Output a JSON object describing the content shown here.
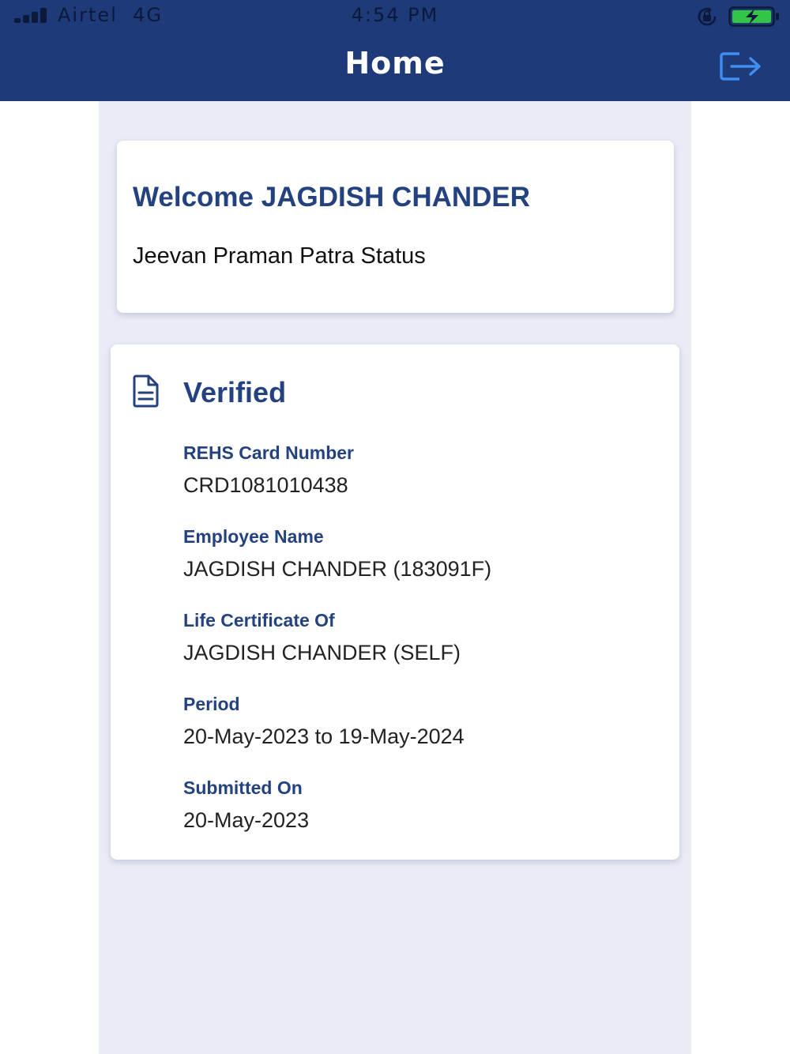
{
  "status_bar": {
    "carrier": "Airtel",
    "network": "4G",
    "time": "4:54 PM"
  },
  "header": {
    "title": "Home",
    "logout_icon": "logout-icon",
    "background_color": "#1f3a78"
  },
  "welcome": {
    "greeting": "Welcome JAGDISH CHANDER",
    "subtitle": "Jeevan Praman Patra Status"
  },
  "status": {
    "icon": "document-icon",
    "title": "Verified",
    "fields": [
      {
        "label": "REHS Card Number",
        "value": "CRD1081010438"
      },
      {
        "label": "Employee Name",
        "value": "JAGDISH CHANDER (183091F)"
      },
      {
        "label": "Life Certificate Of",
        "value": "JAGDISH CHANDER (SELF)"
      },
      {
        "label": "Period",
        "value": "20-May-2023 to 19-May-2024"
      },
      {
        "label": "Submitted On",
        "value": "20-May-2023"
      }
    ]
  },
  "colors": {
    "accent": "#23427f",
    "content_background": "#e9ebf5",
    "battery_fill": "#33c548"
  }
}
